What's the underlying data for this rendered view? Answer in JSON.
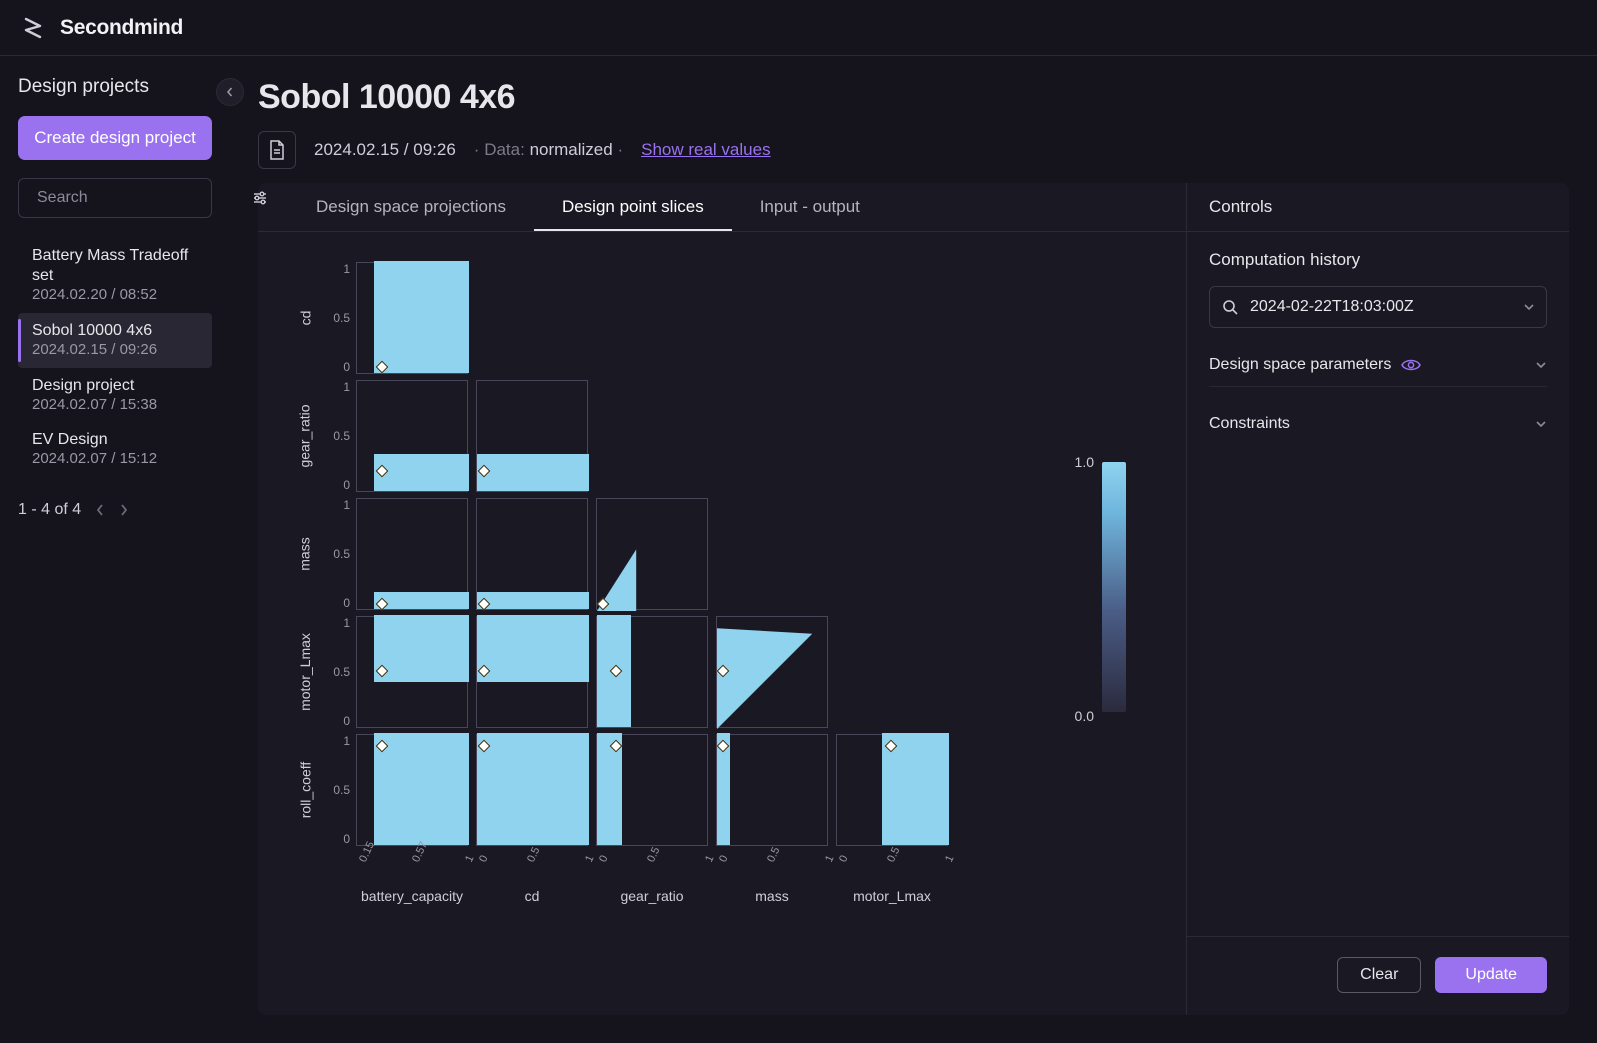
{
  "brand": "Secondmind",
  "sidebar": {
    "title": "Design projects",
    "create_label": "Create design project",
    "search_placeholder": "Search",
    "projects": [
      {
        "name": "Battery Mass Tradeoff set",
        "date": "2024.02.20 / 08:52",
        "active": false
      },
      {
        "name": "Sobol 10000 4x6",
        "date": "2024.02.15 / 09:26",
        "active": true
      },
      {
        "name": "Design project",
        "date": "2024.02.07 / 15:38",
        "active": false
      },
      {
        "name": "EV Design",
        "date": "2024.02.07 / 15:12",
        "active": false
      }
    ],
    "pager_text": "1 - 4 of 4"
  },
  "page": {
    "title": "Sobol 10000 4x6",
    "timestamp": "2024.02.15 / 09:26",
    "data_label": "Data:",
    "data_mode": "normalized",
    "show_real_link": "Show real values"
  },
  "tabs": [
    {
      "label": "Design space projections",
      "active": false
    },
    {
      "label": "Design point slices",
      "active": true
    },
    {
      "label": "Input - output",
      "active": false
    }
  ],
  "controls": {
    "title": "Controls",
    "history_label": "Computation history",
    "history_value": "2024-02-22T18:03:00Z",
    "acc_params": "Design space parameters",
    "acc_constraints": "Constraints",
    "clear_label": "Clear",
    "update_label": "Update"
  },
  "colorbar": {
    "min": "0.0",
    "max": "1.0"
  },
  "chart_data": {
    "type": "heatmap",
    "description": "Lower-triangular pairplot of 2D slices through the feasible design region. Each cell shows the feasible area (blue) in the unit square for the row parameter (y) vs the column parameter (x). A diamond marks the current design-point location in each slice.",
    "row_params": [
      "cd",
      "gear_ratio",
      "mass",
      "motor_Lmax",
      "roll_coeff"
    ],
    "col_params": [
      "battery_capacity",
      "cd",
      "gear_ratio",
      "mass",
      "motor_Lmax"
    ],
    "y_ticks": [
      0,
      0.5,
      1
    ],
    "x_ticks_first_col": [
      0.15,
      0.57,
      1
    ],
    "x_ticks_other_cols": [
      0,
      0.5,
      1
    ],
    "color_scale": {
      "min": 0.0,
      "max": 1.0
    },
    "cells": [
      {
        "row": "cd",
        "col": "battery_capacity",
        "feasible_shape": "rect",
        "x_range": [
          0.15,
          1.0
        ],
        "y_range": [
          0.0,
          1.0
        ],
        "marker": [
          0.22,
          0.07
        ]
      },
      {
        "row": "gear_ratio",
        "col": "battery_capacity",
        "feasible_shape": "rect",
        "x_range": [
          0.15,
          1.0
        ],
        "y_range": [
          0.0,
          0.33
        ],
        "marker": [
          0.22,
          0.2
        ]
      },
      {
        "row": "gear_ratio",
        "col": "cd",
        "feasible_shape": "rect",
        "x_range": [
          0.0,
          1.0
        ],
        "y_range": [
          0.0,
          0.33
        ],
        "marker": [
          0.06,
          0.2
        ]
      },
      {
        "row": "mass",
        "col": "battery_capacity",
        "feasible_shape": "rect",
        "x_range": [
          0.15,
          1.0
        ],
        "y_range": [
          0.0,
          0.15
        ],
        "marker": [
          0.22,
          0.06
        ]
      },
      {
        "row": "mass",
        "col": "cd",
        "feasible_shape": "rect",
        "x_range": [
          0.0,
          1.0
        ],
        "y_range": [
          0.0,
          0.15
        ],
        "marker": [
          0.06,
          0.06
        ]
      },
      {
        "row": "mass",
        "col": "gear_ratio",
        "feasible_shape": "triangle",
        "vertices": [
          [
            0.0,
            0.0
          ],
          [
            0.35,
            0.0
          ],
          [
            0.35,
            0.55
          ],
          [
            0.0,
            0.0
          ]
        ],
        "marker": [
          0.05,
          0.06
        ]
      },
      {
        "row": "motor_Lmax",
        "col": "battery_capacity",
        "feasible_shape": "rect",
        "x_range": [
          0.15,
          1.0
        ],
        "y_range": [
          0.4,
          1.0
        ],
        "marker": [
          0.22,
          0.52
        ]
      },
      {
        "row": "motor_Lmax",
        "col": "cd",
        "feasible_shape": "rect",
        "x_range": [
          0.0,
          1.0
        ],
        "y_range": [
          0.4,
          1.0
        ],
        "marker": [
          0.06,
          0.52
        ]
      },
      {
        "row": "motor_Lmax",
        "col": "gear_ratio",
        "feasible_shape": "rect",
        "x_range": [
          0.0,
          0.3
        ],
        "y_range": [
          0.0,
          1.0
        ],
        "marker": [
          0.17,
          0.52
        ]
      },
      {
        "row": "motor_Lmax",
        "col": "mass",
        "feasible_shape": "triangle",
        "vertices": [
          [
            0.0,
            0.0
          ],
          [
            0.85,
            0.85
          ],
          [
            0.0,
            0.9
          ]
        ],
        "marker": [
          0.05,
          0.52
        ]
      },
      {
        "row": "roll_coeff",
        "col": "battery_capacity",
        "feasible_shape": "rect",
        "x_range": [
          0.15,
          1.0
        ],
        "y_range": [
          0.0,
          1.0
        ],
        "marker": [
          0.22,
          0.9
        ]
      },
      {
        "row": "roll_coeff",
        "col": "cd",
        "feasible_shape": "rect",
        "x_range": [
          0.0,
          1.0
        ],
        "y_range": [
          0.0,
          1.0
        ],
        "marker": [
          0.06,
          0.9
        ]
      },
      {
        "row": "roll_coeff",
        "col": "gear_ratio",
        "feasible_shape": "rect",
        "x_range": [
          0.0,
          0.22
        ],
        "y_range": [
          0.0,
          1.0
        ],
        "marker": [
          0.17,
          0.9
        ]
      },
      {
        "row": "roll_coeff",
        "col": "mass",
        "feasible_shape": "rect",
        "x_range": [
          0.0,
          0.12
        ],
        "y_range": [
          0.0,
          1.0
        ],
        "marker": [
          0.05,
          0.9
        ]
      },
      {
        "row": "roll_coeff",
        "col": "motor_Lmax",
        "feasible_shape": "rect",
        "x_range": [
          0.4,
          1.0
        ],
        "y_range": [
          0.0,
          1.0
        ],
        "marker": [
          0.48,
          0.9
        ]
      }
    ]
  }
}
